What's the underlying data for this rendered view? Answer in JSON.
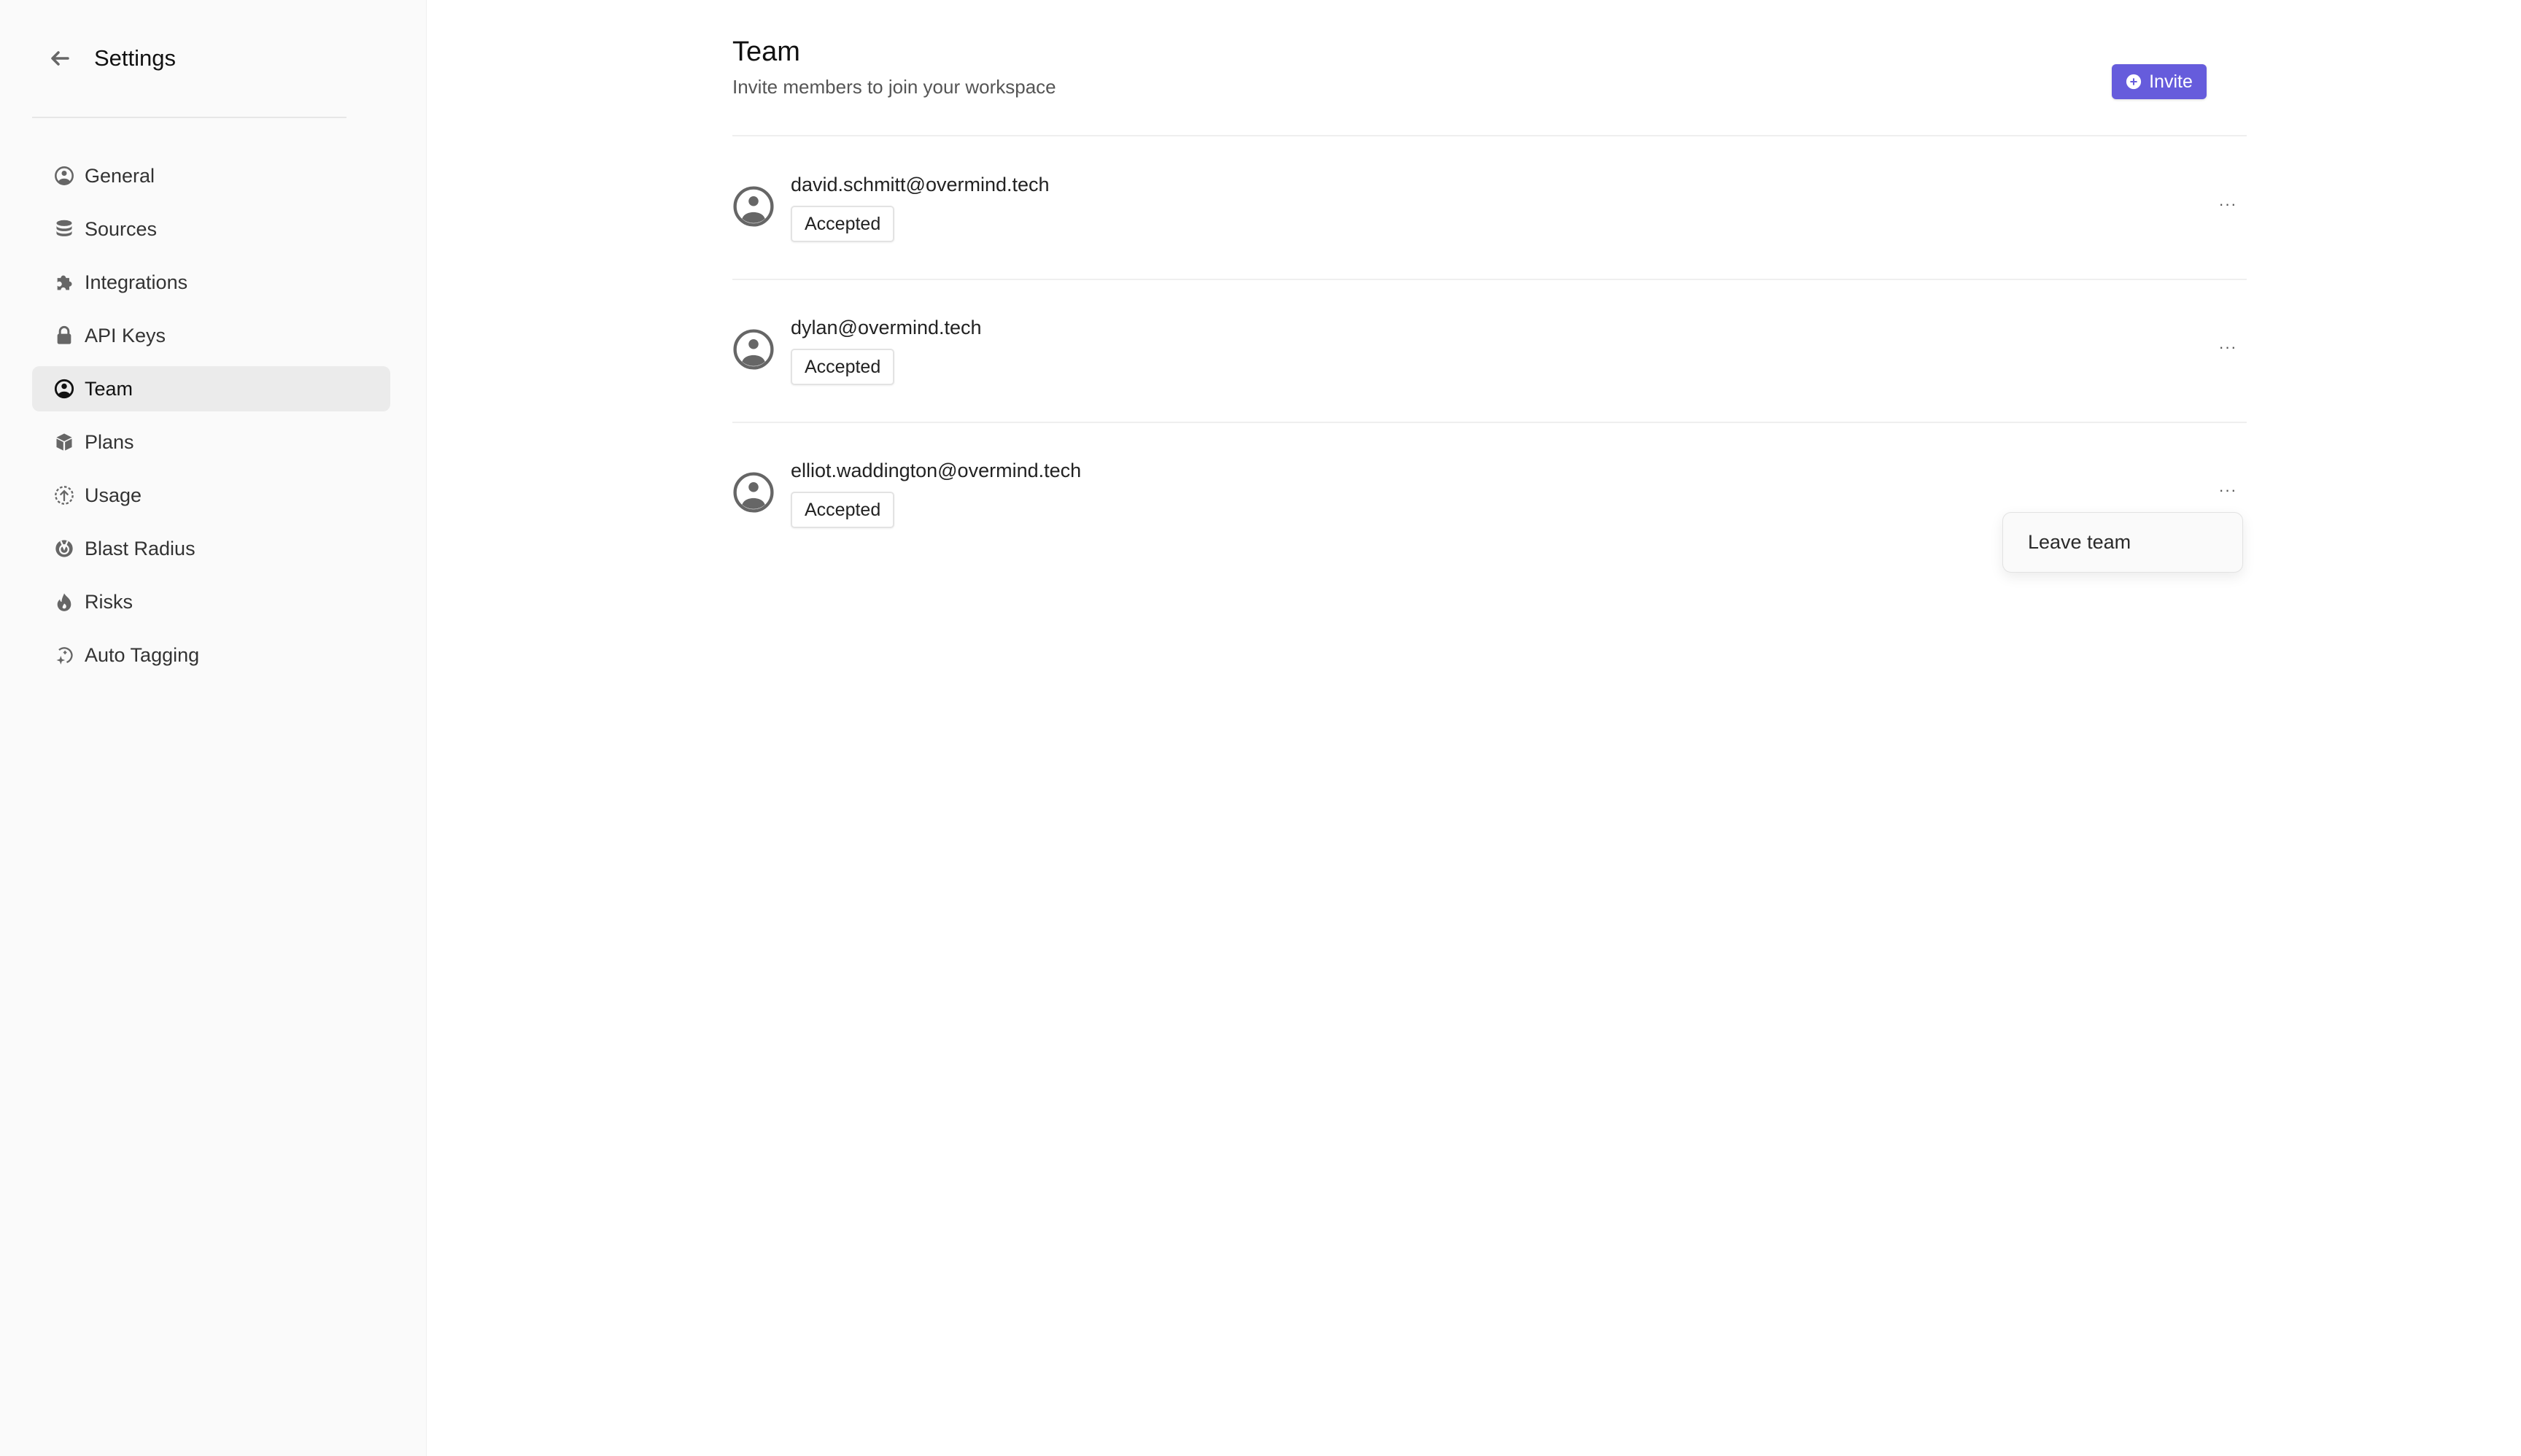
{
  "sidebar": {
    "title": "Settings",
    "back_icon": "arrow-left-icon",
    "items": [
      {
        "label": "General",
        "icon": "user-circle-icon",
        "active": false
      },
      {
        "label": "Sources",
        "icon": "database-icon",
        "active": false
      },
      {
        "label": "Integrations",
        "icon": "puzzle-icon",
        "active": false
      },
      {
        "label": "API Keys",
        "icon": "lock-icon",
        "active": false
      },
      {
        "label": "Team",
        "icon": "user-circle-icon",
        "active": true
      },
      {
        "label": "Plans",
        "icon": "cube-icon",
        "active": false
      },
      {
        "label": "Usage",
        "icon": "arrow-up-circle-dashed-icon",
        "active": false
      },
      {
        "label": "Blast Radius",
        "icon": "radar-icon",
        "active": false
      },
      {
        "label": "Risks",
        "icon": "flame-icon",
        "active": false
      },
      {
        "label": "Auto Tagging",
        "icon": "sparkle-refresh-icon",
        "active": false
      }
    ]
  },
  "main": {
    "title": "Team",
    "subtitle": "Invite members to join your workspace",
    "invite_label": "Invite",
    "accent_color": "#665cdc",
    "members": [
      {
        "email": "david.schmitt@overmind.tech",
        "status": "Accepted"
      },
      {
        "email": "dylan@overmind.tech",
        "status": "Accepted"
      },
      {
        "email": "elliot.waddington@overmind.tech",
        "status": "Accepted"
      }
    ],
    "more_label": "···"
  },
  "dropdown": {
    "items": [
      {
        "label": "Leave team"
      }
    ]
  }
}
